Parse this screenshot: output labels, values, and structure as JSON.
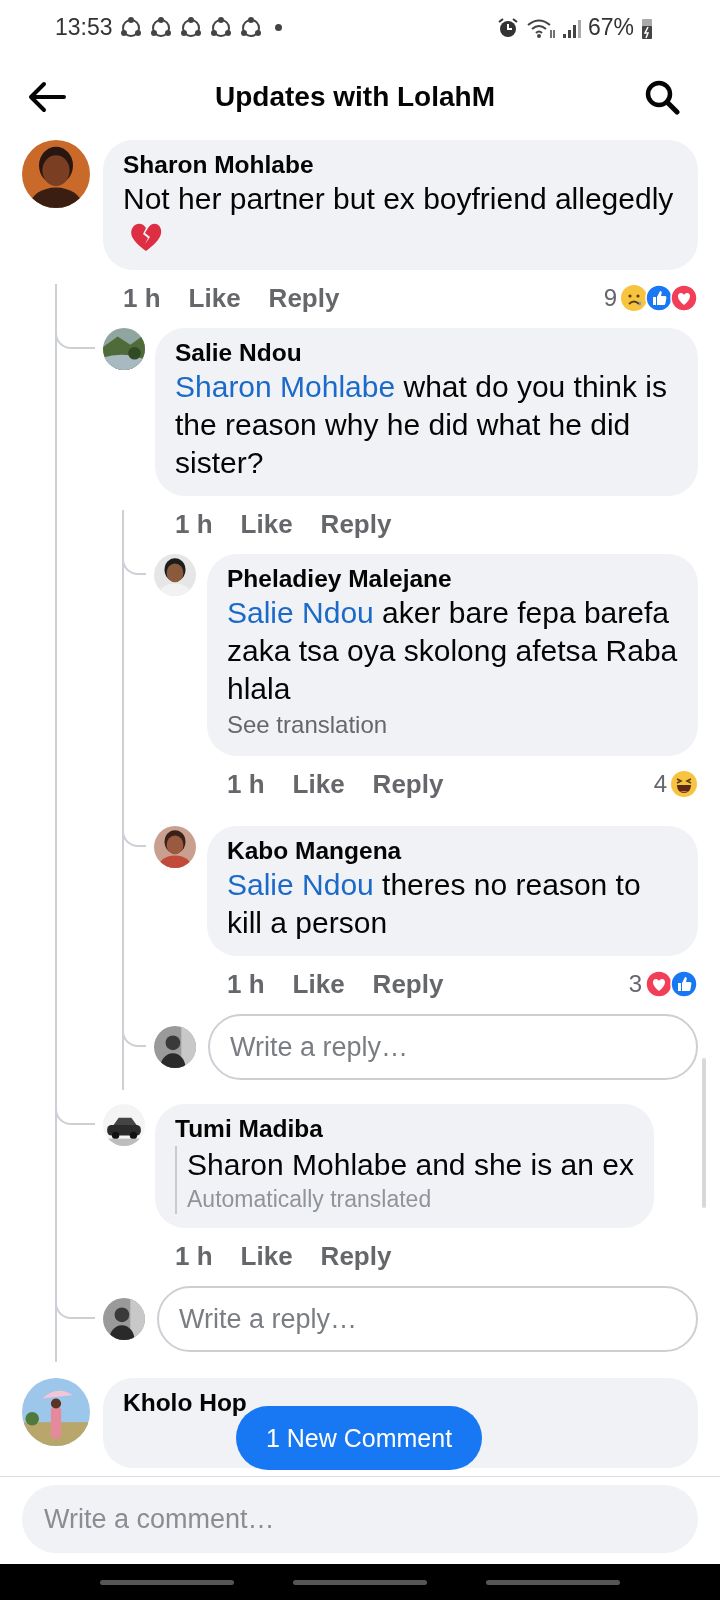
{
  "status_bar": {
    "time": "13:53",
    "battery": "67%"
  },
  "header": {
    "title": "Updates with LolahM"
  },
  "comments": [
    {
      "author": "Sharon Mohlabe",
      "kind": "plain",
      "text": "Not her partner but ex boyfriend allegedly",
      "emoji": {
        "kind": "broken_heart"
      },
      "time": "1 h",
      "actions": [
        "Like",
        "Reply"
      ],
      "reaction_count": "9",
      "reactions": [
        {
          "kind": "sad"
        },
        {
          "kind": "like"
        },
        {
          "kind": "love"
        }
      ],
      "replies": [
        {
          "author": "Salie Ndou",
          "kind": "plain",
          "mention": "Sharon Mohlabe",
          "text": " what do you think is the reason why he did what he did sister?",
          "time": "1 h",
          "actions": [
            "Like",
            "Reply"
          ],
          "replies": [
            {
              "author": "Pheladiey Malejane",
              "kind": "plain",
              "mention": "Salie Ndou",
              "text": " aker bare fepa barefa zaka tsa oya skolong afetsa Raba hlala",
              "note": "See translation",
              "time": "1 h",
              "actions": [
                "Like",
                "Reply"
              ],
              "reaction_count": "4",
              "reactions": [
                {
                  "kind": "haha"
                }
              ]
            },
            {
              "author": "Kabo Mangena",
              "kind": "plain",
              "mention": "Salie Ndou",
              "text": " theres no reason to kill a person",
              "time": "1 h",
              "actions": [
                "Like",
                "Reply"
              ],
              "reaction_count": "3",
              "reactions": [
                {
                  "kind": "love"
                },
                {
                  "kind": "like"
                }
              ]
            }
          ],
          "reply_box": {
            "placeholder": "Write a reply…"
          }
        },
        {
          "author": "Tumi Madiba",
          "kind": "quoted",
          "text": "Sharon Mohlabe and she is an ex",
          "note": "Automatically translated",
          "time": "1 h",
          "actions": [
            "Like",
            "Reply"
          ]
        }
      ],
      "reply_box": {
        "placeholder": "Write a reply…"
      }
    },
    {
      "author": "Kholo Hop",
      "kind": "cut"
    }
  ],
  "new_comments_button": "1 New Comment",
  "comment_box": {
    "placeholder": "Write a comment…"
  }
}
